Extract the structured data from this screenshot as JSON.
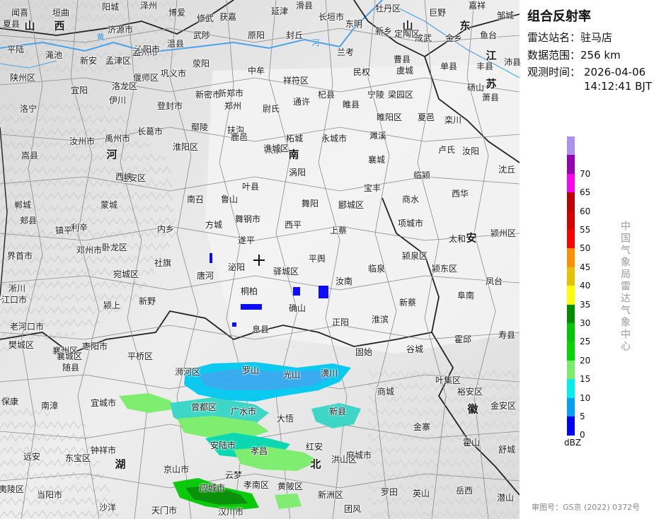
{
  "panel": {
    "title": "组合反射率",
    "station_label": "雷达站名：驻马店",
    "range_label": "数据范围：256 km",
    "time_label": "观测时间：",
    "time_date": "2026-04-06",
    "time_clock": "14:12:41 BJT",
    "legend_unit": "dBZ",
    "vertical_credit": "中国气象局雷达气象中心",
    "approval": "审图号：GS京 (2022) 0372号"
  },
  "legend": [
    {
      "label": "",
      "color": "#ad90f0"
    },
    {
      "label": "70",
      "color": "#9600b4"
    },
    {
      "label": "65",
      "color": "#ff00f0"
    },
    {
      "label": "60",
      "color": "#c00000"
    },
    {
      "label": "55",
      "color": "#d60000"
    },
    {
      "label": "50",
      "color": "#ff0000"
    },
    {
      "label": "45",
      "color": "#ff9000"
    },
    {
      "label": "40",
      "color": "#e7c000"
    },
    {
      "label": "35",
      "color": "#ffff00"
    },
    {
      "label": "30",
      "color": "#008c00"
    },
    {
      "label": "25",
      "color": "#00c800"
    },
    {
      "label": "20",
      "color": "#00d800"
    },
    {
      "label": "15",
      "color": "#7aee6a"
    },
    {
      "label": "10",
      "color": "#00eeec"
    },
    {
      "label": "5",
      "color": "#01a0f6"
    },
    {
      "label": "0",
      "color": "#0000f6"
    }
  ],
  "map": {
    "provinces": [
      "山",
      "西",
      "河",
      "南",
      "湖",
      "北",
      "安",
      "徽",
      "东",
      "江",
      "苏",
      "山"
    ],
    "rivers": [
      "黄",
      "河"
    ],
    "places": [
      "闻喜",
      "垣曲",
      "阳城",
      "泽州",
      "博爱",
      "修武",
      "获嘉",
      "延津",
      "滑县",
      "长垣市",
      "东明",
      "牡丹区",
      "巨野",
      "嘉祥",
      "邹城",
      "夏县",
      "平陆",
      "渑池",
      "新安",
      "孟津区",
      "孟州市",
      "温县",
      "武陟",
      "原阳",
      "封丘",
      "兰考",
      "曹县",
      "成武",
      "金乡",
      "鱼台",
      "济源市",
      "沁阳市",
      "新乡",
      "定陶区",
      "单县",
      "丰县",
      "沛县",
      "陕州区",
      "宜阳",
      "洛龙区",
      "偃师区",
      "巩义市",
      "荥阳",
      "中牟",
      "祥符区",
      "民权",
      "虞城",
      "砀山",
      "伊川",
      "新郑市",
      "郑州",
      "尉氏",
      "通许",
      "杞县",
      "睢县",
      "宁陵",
      "梁园区",
      "萧县",
      "洛宁",
      "登封市",
      "新密市",
      "睢阳区",
      "夏邑",
      "栾川",
      "嵩县",
      "汝州市",
      "禹州市",
      "长葛市",
      "鄢陵",
      "扶沟",
      "太康",
      "柘城",
      "永城市",
      "濉溪",
      "卢氏",
      "汝阳",
      "郏县",
      "建安区",
      "淮阳区",
      "鹿邑",
      "谯城区",
      "涡阳",
      "宝丰",
      "襄城",
      "临颍",
      "西华",
      "郸城",
      "蒙城",
      "西峡",
      "南召",
      "鲁山",
      "叶县",
      "舞阳",
      "郾城区",
      "商水",
      "沈丘",
      "界首市",
      "利辛",
      "内乡",
      "方城",
      "舞钢市",
      "西平",
      "上蔡",
      "项城市",
      "太和",
      "颍州区",
      "淅川",
      "镇平",
      "卧龙区",
      "社旗",
      "遂平",
      "平舆",
      "临泉",
      "颍泉区",
      "颍东区",
      "凤台",
      "丹江口市",
      "邓州市",
      "宛城区",
      "唐河",
      "泌阳",
      "驿城区",
      "汝南",
      "新蔡",
      "阜南",
      "颍上",
      "新野",
      "桐柏",
      "确山",
      "正阳",
      "淮滨",
      "霍邱",
      "寿县",
      "老河口市",
      "襄州区",
      "枣阳市",
      "平桥区",
      "息县",
      "固始",
      "谷城",
      "樊城区",
      "襄城区",
      "随县",
      "浉河区",
      "罗山",
      "光山",
      "潢川",
      "叶集区",
      "保康",
      "南漳",
      "宜城市",
      "曾都区",
      "广水市",
      "大悟",
      "新县",
      "商城",
      "裕安区",
      "金安区",
      "钟祥市",
      "安陆市",
      "孝昌",
      "红安",
      "麻城市",
      "金寨",
      "霍山",
      "舒城",
      "远安",
      "东宝区",
      "京山市",
      "云梦",
      "孝南区",
      "黄陂区",
      "新洲区",
      "罗田",
      "英山",
      "岳西",
      "潜山",
      "当阳市",
      "沙洋",
      "天门市",
      "应城市",
      "汉川市",
      "团风",
      "夷陵区",
      "洪山区"
    ]
  }
}
